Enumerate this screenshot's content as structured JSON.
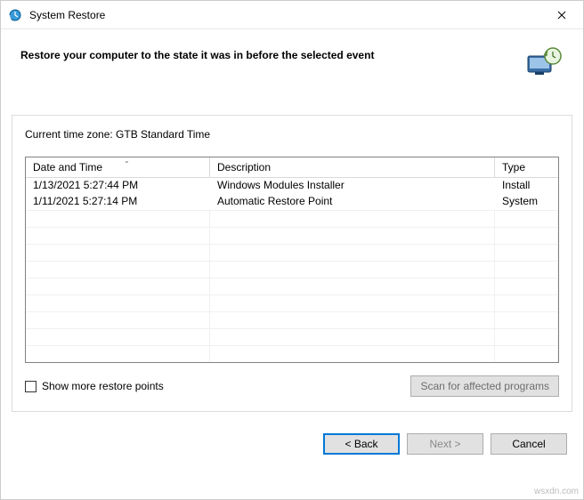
{
  "window": {
    "title": "System Restore"
  },
  "header": {
    "heading": "Restore your computer to the state it was in before the selected event"
  },
  "timezone": {
    "label": "Current time zone: GTB Standard Time"
  },
  "table": {
    "columns": {
      "datetime": "Date and Time",
      "description": "Description",
      "type": "Type"
    },
    "rows": [
      {
        "datetime": "1/13/2021 5:27:44 PM",
        "description": "Windows Modules Installer",
        "type": "Install"
      },
      {
        "datetime": "1/11/2021 5:27:14 PM",
        "description": "Automatic Restore Point",
        "type": "System"
      }
    ]
  },
  "options": {
    "show_more_label": "Show more restore points",
    "scan_label": "Scan for affected programs"
  },
  "buttons": {
    "back": "< Back",
    "next": "Next >",
    "cancel": "Cancel"
  },
  "watermark": "wsxdn.com"
}
